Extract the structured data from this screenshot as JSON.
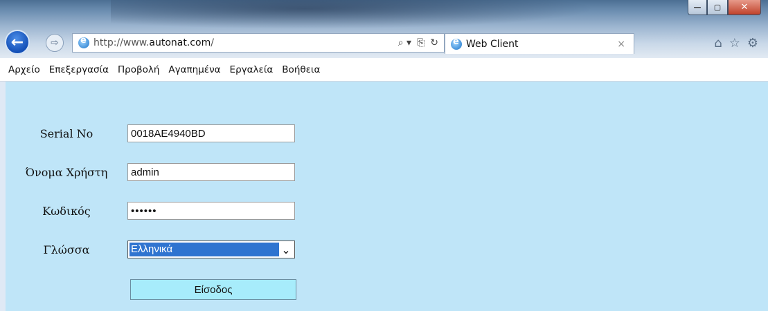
{
  "window": {
    "minimize_glyph": "—",
    "maximize_glyph": "▢",
    "close_glyph": "✕"
  },
  "navigation": {
    "back_glyph": "←",
    "forward_glyph": "⇨"
  },
  "address_bar": {
    "url_prefix": "http://www.",
    "url_domain": "autonat.com",
    "url_suffix": "/",
    "search_glyph": "⌕ ▾",
    "compat_glyph": "⎘",
    "refresh_glyph": "↻"
  },
  "tab": {
    "title": "Web Client",
    "close_glyph": "×"
  },
  "toolbar_icons": {
    "home": "⌂",
    "favorites": "☆",
    "settings": "⚙"
  },
  "menu": {
    "items": [
      "Αρχείο",
      "Επεξεργασία",
      "Προβολή",
      "Αγαπημένα",
      "Εργαλεία",
      "Βοήθεια"
    ]
  },
  "form": {
    "serial_label": "Serial No",
    "serial_value": "0018AE4940BD",
    "username_label": "Όνομα Χρήστη",
    "username_value": "admin",
    "password_label": "Κωδικός",
    "password_value": "••••••",
    "language_label": "Γλώσσα",
    "language_value": "Ελληνικά",
    "login_button": "Είσοδος"
  },
  "colors": {
    "page_background": "#bfe5f8",
    "login_button": "#a7ecfb",
    "select_highlight": "#2f74d0"
  }
}
